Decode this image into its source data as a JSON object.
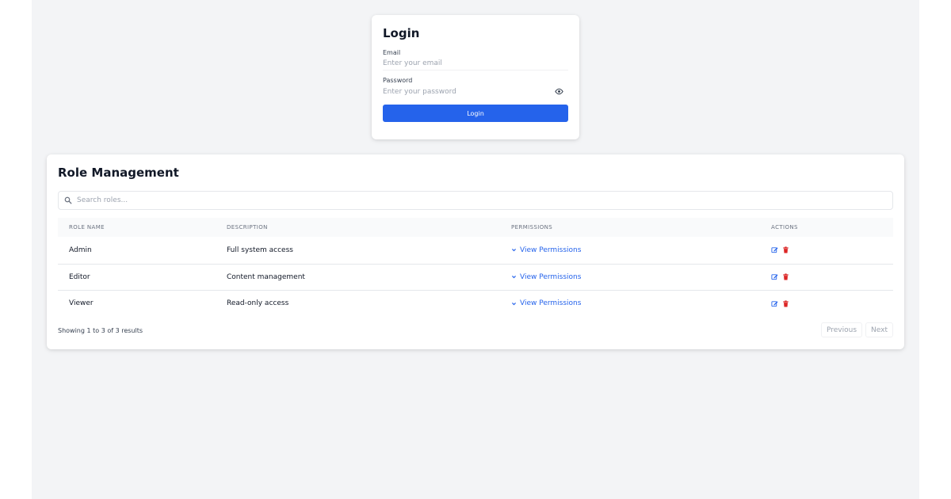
{
  "login": {
    "title": "Login",
    "email_label": "Email",
    "email_placeholder": "Enter your email",
    "email_value": "",
    "password_label": "Password",
    "password_placeholder": "Enter your password",
    "password_value": "",
    "eye_icon": "eye-icon",
    "submit_label": "Login"
  },
  "roles": {
    "title": "Role Management",
    "search_placeholder": "Search roles...",
    "search_value": "",
    "columns": [
      "ROLE NAME",
      "DESCRIPTION",
      "PERMISSIONS",
      "ACTIONS"
    ],
    "rows": [
      {
        "name": "Admin",
        "description": "Full system access",
        "permissions_link": "View Permissions"
      },
      {
        "name": "Editor",
        "description": "Content management",
        "permissions_link": "View Permissions"
      },
      {
        "name": "Viewer",
        "description": "Read-only access",
        "permissions_link": "View Permissions"
      }
    ],
    "footer": "Showing 1 to 3 of 3 results",
    "pager": {
      "previous": "Previous",
      "next": "Next"
    }
  },
  "colors": {
    "primary": "#2563eb",
    "danger": "#dc2626",
    "background": "#f3f4f6"
  }
}
